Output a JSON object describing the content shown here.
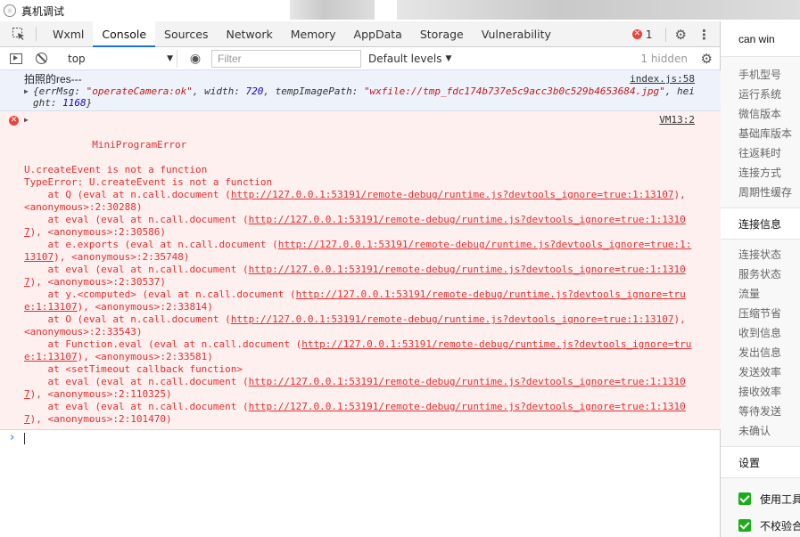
{
  "window": {
    "title": "真机调试"
  },
  "tabs": [
    {
      "label": "Wxml",
      "active": false
    },
    {
      "label": "Console",
      "active": true
    },
    {
      "label": "Sources",
      "active": false
    },
    {
      "label": "Network",
      "active": false
    },
    {
      "label": "Memory",
      "active": false
    },
    {
      "label": "AppData",
      "active": false
    },
    {
      "label": "Storage",
      "active": false
    },
    {
      "label": "Vulnerability",
      "active": false
    }
  ],
  "error_count": "1",
  "toolbar": {
    "context": "top",
    "filter_placeholder": "Filter",
    "levels": "Default levels",
    "hidden": "1 hidden"
  },
  "console": {
    "log": {
      "text": "拍照的res---",
      "source": "index.js:58",
      "object": {
        "open": "{",
        "k1": "errMsg",
        "v1": "\"operateCamera:ok\"",
        "k2": "width",
        "v2": "720",
        "k3": "tempImagePath",
        "v3": "\"wxfile://tmp_fdc174b737e5c9acc3b0c529b4653684.jpg\"",
        "k4": "height",
        "v4": "1168",
        "close": "}"
      }
    },
    "error": {
      "name": "MiniProgramError",
      "source": "VM13:2",
      "message": "U.createEvent is not a function",
      "type_line": "TypeError: U.createEvent is not a function",
      "trace": [
        {
          "pre": "    at Q (eval at n.call.document (",
          "url": "http://127.0.0.1:53191/remote-debug/runtime.js?devtools_ignore=true:1:13107",
          "post": "), <anonymous>:2:30288)"
        },
        {
          "pre": "    at eval (eval at n.call.document (",
          "url": "http://127.0.0.1:53191/remote-debug/runtime.js?devtools_ignore=true:1:13107",
          "post": "), <anonymous>:2:30586)"
        },
        {
          "pre": "    at e.exports (eval at n.call.document (",
          "url": "http://127.0.0.1:53191/remote-debug/runtime.js?devtools_ignore=true:1:13107",
          "post": "), <anonymous>:2:35748)"
        },
        {
          "pre": "    at eval (eval at n.call.document (",
          "url": "http://127.0.0.1:53191/remote-debug/runtime.js?devtools_ignore=true:1:13107",
          "post": "), <anonymous>:2:30537)"
        },
        {
          "pre": "    at y.<computed> (eval at n.call.document (",
          "url": "http://127.0.0.1:53191/remote-debug/runtime.js?devtools_ignore=true:1:13107",
          "post": "), <anonymous>:2:33814)"
        },
        {
          "pre": "    at O (eval at n.call.document (",
          "url": "http://127.0.0.1:53191/remote-debug/runtime.js?devtools_ignore=true:1:13107",
          "post": "), <anonymous>:2:33543)"
        },
        {
          "pre": "    at Function.eval (eval at n.call.document (",
          "url": "http://127.0.0.1:53191/remote-debug/runtime.js?devtools_ignore=true:1:13107",
          "post": "), <anonymous>:2:33581)"
        },
        {
          "pre": "    at <setTimeout callback function>",
          "url": "",
          "post": ""
        },
        {
          "pre": "    at eval (eval at n.call.document (",
          "url": "http://127.0.0.1:53191/remote-debug/runtime.js?devtools_ignore=true:1:13107",
          "post": "), <anonymous>:2:110325)"
        },
        {
          "pre": "    at eval (eval at n.call.document (",
          "url": "http://127.0.0.1:53191/remote-debug/runtime.js?devtools_ignore=true:1:13107",
          "post": "), <anonymous>:2:101470)"
        }
      ]
    }
  },
  "panel": {
    "header": "can win",
    "items": [
      "手机型号",
      "运行系统",
      "微信版本",
      "基础库版本",
      "往返耗时",
      "连接方式",
      "周期性缓存"
    ],
    "section_connection": "连接信息",
    "connection_items": [
      "连接状态",
      "服务状态",
      "流量",
      "压缩节省",
      "收到信息",
      "发出信息",
      "发送效率",
      "接收效率",
      "等待发送",
      "未确认"
    ],
    "section_settings": "设置",
    "checkboxes": [
      "使用工具",
      "不校验合"
    ]
  },
  "icons": {
    "app": "app-logo-icon",
    "inspect": "inspect-element-icon",
    "sidebar": "console-sidebar-icon",
    "clear": "clear-console-icon",
    "eye": "live-expression-icon",
    "gear": "settings-gear-icon",
    "more": "more-options-icon",
    "error": "error-icon",
    "prompt": "prompt-chevron-icon"
  },
  "colors": {
    "accent": "#1a73e8",
    "error": "#e8453c",
    "error_text": "#e52e2e",
    "check": "#1aad19"
  }
}
